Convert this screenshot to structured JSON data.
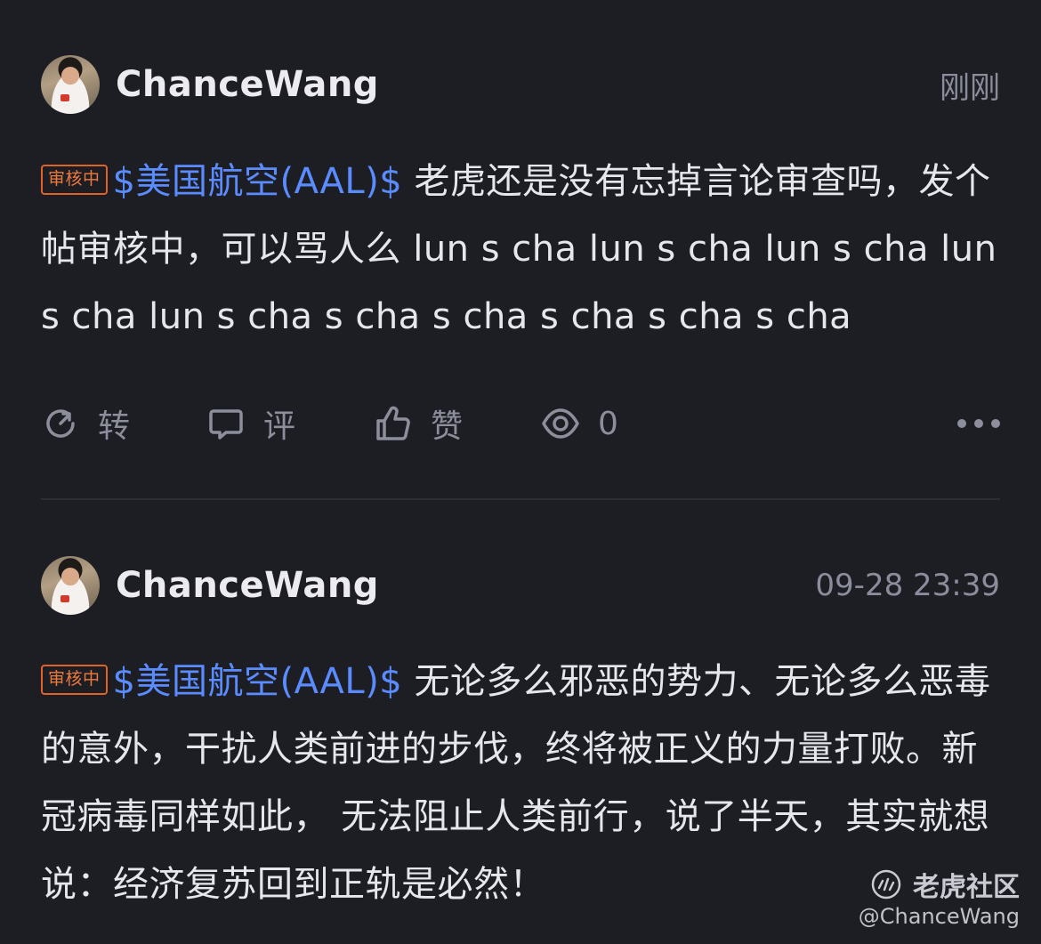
{
  "posts": [
    {
      "username": "ChanceWang",
      "time": "刚刚",
      "badge": "审核中",
      "ticker": "$美国航空(AAL)$",
      "text": " 老虎还是没有忘掉言论审查吗，发个帖审核中，可以骂人么 lun s cha lun s cha lun s cha lun s cha lun s cha s cha s cha s cha s cha s cha",
      "actions": {
        "repost": "转",
        "comment": "评",
        "like": "赞",
        "views": "0"
      }
    },
    {
      "username": "ChanceWang",
      "time": "09-28 23:39",
      "badge": "审核中",
      "ticker": "$美国航空(AAL)$",
      "text": " 无论多么邪恶的势力、无论多么恶毒的意外，干扰人类前进的步伐，终将被正义的力量打败。新冠病毒同样如此， 无法阻止人类前行，说了半天，其实就想说：经济复苏回到正轨是必然！"
    }
  ],
  "watermark": {
    "brand": "老虎社区",
    "handle": "@ChanceWang"
  },
  "colors": {
    "background": "#1d1e24",
    "ticker": "#5b8cff",
    "badge": "#e0622a",
    "muted": "#8c8e9c"
  },
  "icons": {
    "repost": "repost-icon",
    "comment": "comment-icon",
    "like": "thumbs-up-icon",
    "views": "eye-icon",
    "more": "more-icon"
  }
}
